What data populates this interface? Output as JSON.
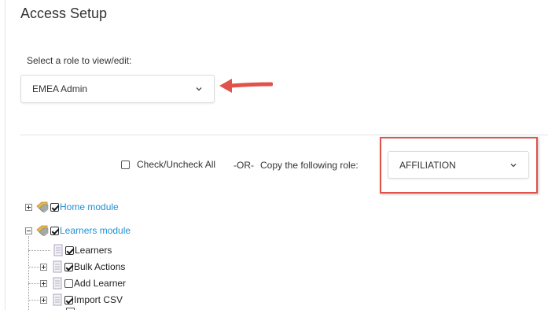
{
  "page": {
    "title": "Access Setup"
  },
  "role_picker": {
    "label": "Select a role to view/edit:",
    "selected": "EMEA Admin"
  },
  "copy_controls": {
    "check_all_label": "Check/Uncheck All",
    "or_text": "-OR-",
    "copy_label": "Copy the following role:",
    "copy_selected": "AFFILIATION"
  },
  "tree": {
    "modules": [
      {
        "label": "Home module",
        "checked": true,
        "expanded": false
      },
      {
        "label": "Learners module",
        "checked": true,
        "expanded": true,
        "children": [
          {
            "label": "Learners",
            "checked": true,
            "expandable": false
          },
          {
            "label": "Bulk Actions",
            "checked": true,
            "expandable": true
          },
          {
            "label": "Add Learner",
            "checked": false,
            "expandable": true
          },
          {
            "label": "Import CSV",
            "checked": true,
            "expandable": true
          }
        ]
      }
    ]
  },
  "colors": {
    "link": "#1e90d6",
    "annotation": "#e0524a"
  },
  "icons": [
    "chevron-down-icon",
    "red-arrow-annotation",
    "tag-icon",
    "document-icon",
    "expand-collapse-icon"
  ]
}
